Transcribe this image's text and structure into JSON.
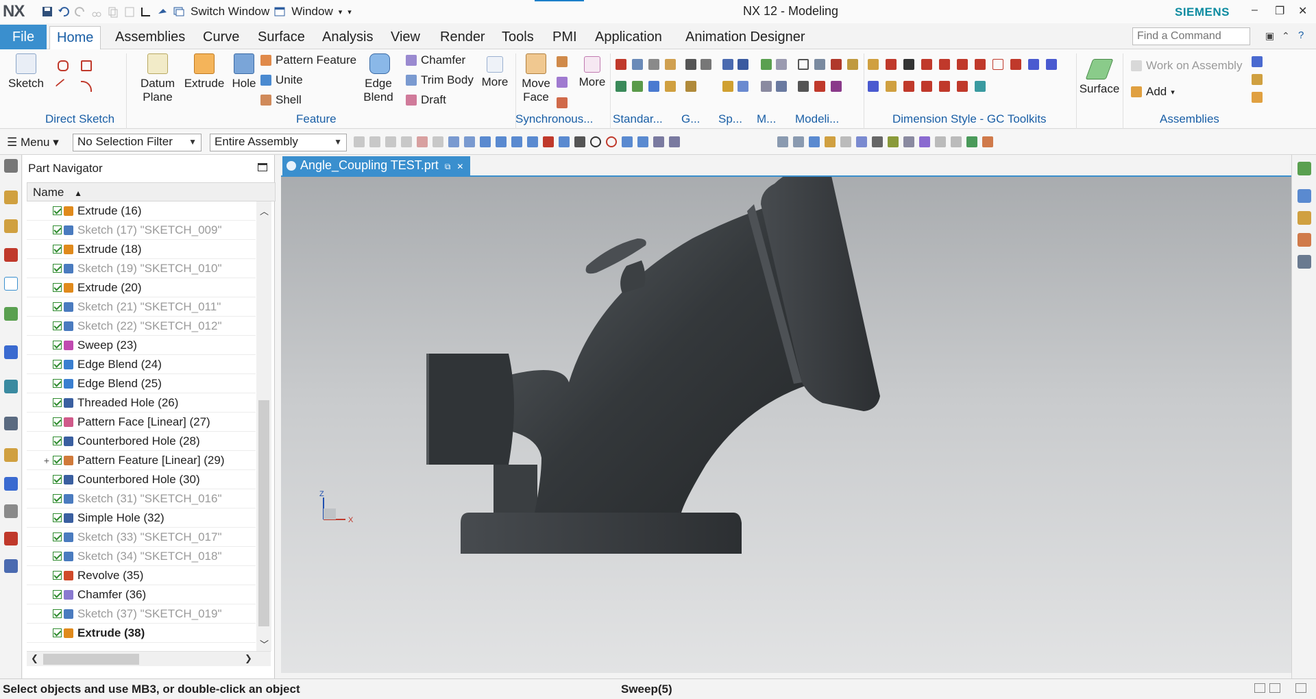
{
  "app": {
    "logo": "NX",
    "title": "NX 12 - Modeling",
    "brand": "SIEMENS",
    "switch_window": "Switch Window",
    "window_menu": "Window",
    "controls": {
      "minimize": "–",
      "restore": "❐",
      "close": "✕"
    }
  },
  "ribbon_tabs": [
    "File",
    "Home",
    "Assemblies",
    "Curve",
    "Surface",
    "Analysis",
    "View",
    "Render",
    "Tools",
    "PMI",
    "Application",
    "Animation Designer"
  ],
  "active_tab": "Home",
  "find_command": {
    "placeholder": "Find a Command"
  },
  "ribbon": {
    "direct_sketch": {
      "label": "Direct Sketch",
      "sketch": "Sketch"
    },
    "feature": {
      "label": "Feature",
      "datum_plane": "Datum Plane",
      "extrude": "Extrude",
      "hole": "Hole",
      "pattern_feature": "Pattern Feature",
      "unite": "Unite",
      "shell": "Shell",
      "edge_blend": "Edge Blend",
      "chamfer": "Chamfer",
      "trim_body": "Trim Body",
      "draft": "Draft",
      "more": "More"
    },
    "synchronous": {
      "label": "Synchronous...",
      "move_face": "Move Face",
      "more": "More"
    },
    "standard": {
      "label": "Standar..."
    },
    "g": {
      "label": "G..."
    },
    "sp": {
      "label": "Sp..."
    },
    "m": {
      "label": "M..."
    },
    "modeling": {
      "label": "Modeli..."
    },
    "dimension_style": {
      "label": "Dimension Style - GC Toolkits"
    },
    "surface": {
      "label": "Surface"
    },
    "assemblies": {
      "label": "Assemblies",
      "work_on_assembly": "Work on Assembly",
      "add": "Add"
    }
  },
  "selection_bar": {
    "menu": "Menu",
    "filter": "No Selection Filter",
    "scope": "Entire Assembly"
  },
  "part_navigator": {
    "title": "Part Navigator",
    "column": "Name",
    "rows": [
      {
        "label": "Extrude (16)",
        "dim": false,
        "bold": false,
        "expand": "",
        "color": "#e08a1c"
      },
      {
        "label": "Sketch (17) \"SKETCH_009\"",
        "dim": true,
        "bold": false,
        "expand": "",
        "color": "#4a7bbf"
      },
      {
        "label": "Extrude (18)",
        "dim": false,
        "bold": false,
        "expand": "",
        "color": "#e08a1c"
      },
      {
        "label": "Sketch (19) \"SKETCH_010\"",
        "dim": true,
        "bold": false,
        "expand": "",
        "color": "#4a7bbf"
      },
      {
        "label": "Extrude (20)",
        "dim": false,
        "bold": false,
        "expand": "",
        "color": "#e08a1c"
      },
      {
        "label": "Sketch (21) \"SKETCH_011\"",
        "dim": true,
        "bold": false,
        "expand": "",
        "color": "#4a7bbf"
      },
      {
        "label": "Sketch (22) \"SKETCH_012\"",
        "dim": true,
        "bold": false,
        "expand": "",
        "color": "#4a7bbf"
      },
      {
        "label": "Sweep (23)",
        "dim": false,
        "bold": false,
        "expand": "",
        "color": "#c04ab0"
      },
      {
        "label": "Edge Blend (24)",
        "dim": false,
        "bold": false,
        "expand": "",
        "color": "#3a7fd0"
      },
      {
        "label": "Edge Blend (25)",
        "dim": false,
        "bold": false,
        "expand": "",
        "color": "#3a7fd0"
      },
      {
        "label": "Threaded Hole (26)",
        "dim": false,
        "bold": false,
        "expand": "",
        "color": "#3a5fa0"
      },
      {
        "label": "Pattern Face [Linear] (27)",
        "dim": false,
        "bold": false,
        "expand": "",
        "color": "#d05a8a"
      },
      {
        "label": "Counterbored Hole (28)",
        "dim": false,
        "bold": false,
        "expand": "",
        "color": "#3a5fa0"
      },
      {
        "label": "Pattern Feature [Linear] (29)",
        "dim": false,
        "bold": false,
        "expand": "+",
        "color": "#d07a3a"
      },
      {
        "label": "Counterbored Hole (30)",
        "dim": false,
        "bold": false,
        "expand": "",
        "color": "#3a5fa0"
      },
      {
        "label": "Sketch (31) \"SKETCH_016\"",
        "dim": true,
        "bold": false,
        "expand": "",
        "color": "#4a7bbf"
      },
      {
        "label": "Simple Hole (32)",
        "dim": false,
        "bold": false,
        "expand": "",
        "color": "#3a5fa0"
      },
      {
        "label": "Sketch (33) \"SKETCH_017\"",
        "dim": true,
        "bold": false,
        "expand": "",
        "color": "#4a7bbf"
      },
      {
        "label": "Sketch (34) \"SKETCH_018\"",
        "dim": true,
        "bold": false,
        "expand": "",
        "color": "#4a7bbf"
      },
      {
        "label": "Revolve (35)",
        "dim": false,
        "bold": false,
        "expand": "",
        "color": "#d04a2a"
      },
      {
        "label": "Chamfer (36)",
        "dim": false,
        "bold": false,
        "expand": "",
        "color": "#8a7ad0"
      },
      {
        "label": "Sketch (37) \"SKETCH_019\"",
        "dim": true,
        "bold": false,
        "expand": "",
        "color": "#4a7bbf"
      },
      {
        "label": "Extrude (38)",
        "dim": false,
        "bold": true,
        "expand": "",
        "color": "#e08a1c"
      }
    ]
  },
  "document_tab": {
    "name": "Angle_Coupling TEST.prt",
    "close": "✕"
  },
  "triad": {
    "z": "Z",
    "x": "X"
  },
  "status": {
    "prompt": "Select objects and use MB3, or double-click an object",
    "feature": "Sweep(5)"
  },
  "colors": {
    "accent": "#3a8fce",
    "group_label": "#1a5fa6",
    "brand": "#0c8ba0",
    "model": "#3a3d40"
  }
}
